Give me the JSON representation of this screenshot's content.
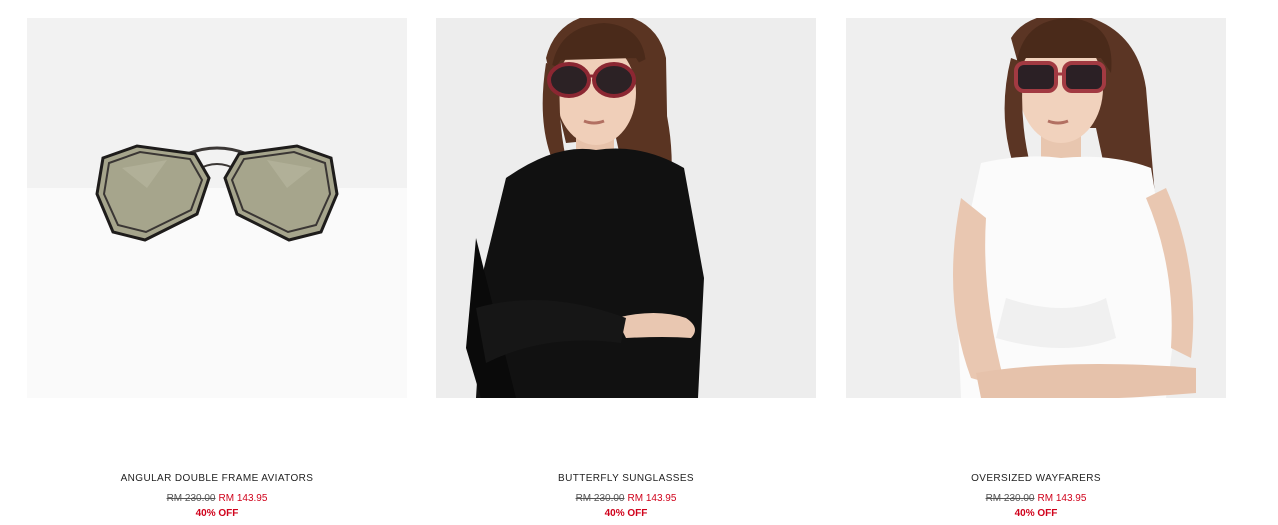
{
  "products": [
    {
      "name": "ANGULAR DOUBLE FRAME AVIATORS",
      "old_price": "RM 230.00",
      "new_price": "RM 143.95",
      "discount": "40% OFF",
      "image": "sunglasses-product-image"
    },
    {
      "name": "BUTTERFLY SUNGLASSES",
      "old_price": "RM 230.00",
      "new_price": "RM 143.95",
      "discount": "40% OFF",
      "image": "model-black-dress-image"
    },
    {
      "name": "OVERSIZED WAYFARERS",
      "old_price": "RM 230.00",
      "new_price": "RM 143.95",
      "discount": "40% OFF",
      "image": "model-white-top-image"
    }
  ],
  "colors": {
    "sale_red": "#d0021b",
    "text": "#222222",
    "strike": "#555555"
  }
}
